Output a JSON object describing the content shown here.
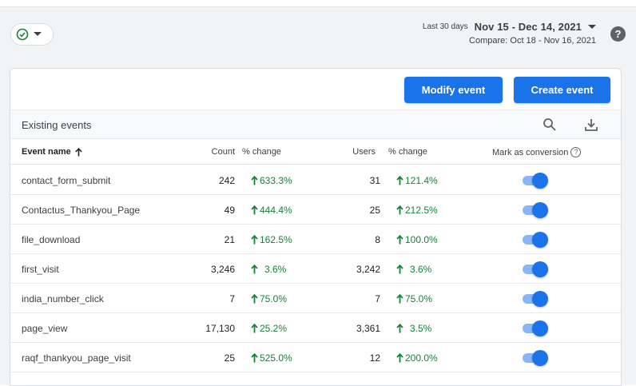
{
  "header": {
    "range_label": "Last 30 days",
    "range_value": "Nov 15 - Dec 14, 2021",
    "compare": "Compare: Oct 18 - Nov 16, 2021",
    "help": "?"
  },
  "toolbar": {
    "modify_label": "Modify event",
    "create_label": "Create event"
  },
  "section": {
    "title": "Existing events"
  },
  "table": {
    "headers": {
      "name": "Event name",
      "count": "Count",
      "pct1": "% change",
      "users": "Users",
      "pct2": "% change",
      "conversion": "Mark as conversion"
    },
    "rows": [
      {
        "name": "contact_form_submit",
        "count": "242",
        "count_change": "633.3%",
        "users": "31",
        "users_change": "121.4%",
        "conversion": true
      },
      {
        "name": "Contactus_Thankyou_Page",
        "count": "49",
        "count_change": "444.4%",
        "users": "25",
        "users_change": "212.5%",
        "conversion": true
      },
      {
        "name": "file_download",
        "count": "21",
        "count_change": "162.5%",
        "users": "8",
        "users_change": "100.0%",
        "conversion": true
      },
      {
        "name": "first_visit",
        "count": "3,246",
        "count_change": "3.6%",
        "users": "3,242",
        "users_change": "3.6%",
        "conversion": true
      },
      {
        "name": "india_number_click",
        "count": "7",
        "count_change": "75.0%",
        "users": "7",
        "users_change": "75.0%",
        "conversion": true
      },
      {
        "name": "page_view",
        "count": "17,130",
        "count_change": "25.2%",
        "users": "3,361",
        "users_change": "3.5%",
        "conversion": true
      },
      {
        "name": "raqf_thankyou_page_visit",
        "count": "25",
        "count_change": "525.0%",
        "users": "12",
        "users_change": "200.0%",
        "conversion": true
      }
    ]
  },
  "colors": {
    "accent": "#1a73e8",
    "positive": "#188038",
    "status_ok": "#188038"
  },
  "icons": [
    "check-circle-icon",
    "dropdown-caret-icon",
    "help-icon",
    "search-icon",
    "download-icon",
    "sort-arrow-up-icon",
    "arrow-up-icon"
  ]
}
